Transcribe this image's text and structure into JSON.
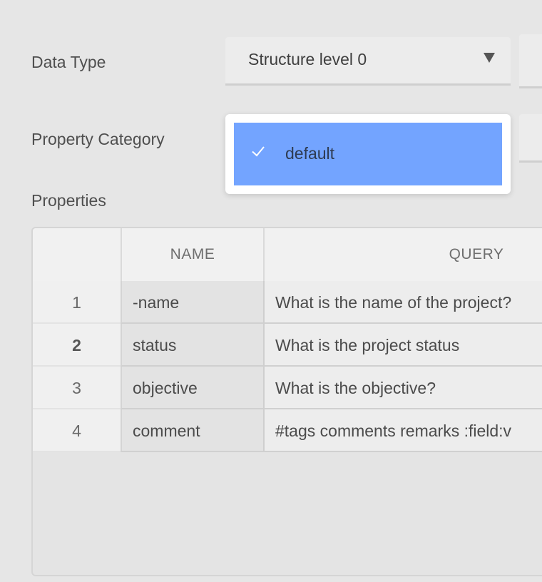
{
  "form": {
    "data_type_label": "Data Type",
    "data_type_value": "Structure level 0",
    "property_category_label": "Property Category",
    "properties_label": "Properties"
  },
  "dropdown": {
    "options": [
      {
        "label": "default",
        "selected": true
      }
    ],
    "selected_color": "#73a4ff"
  },
  "table": {
    "columns": [
      "NAME",
      "QUERY"
    ],
    "rows": [
      {
        "index": "1",
        "name": "-name",
        "query": "What is the name of the project?"
      },
      {
        "index": "2",
        "name": "status",
        "query": "What is the project status"
      },
      {
        "index": "3",
        "name": "objective",
        "query": "What is the objective?"
      },
      {
        "index": "4",
        "name": "comment",
        "query": "#tags comments remarks :field:v"
      }
    ]
  },
  "icons": {
    "select_arrow": "chevron-down-icon",
    "option_check": "check-icon"
  }
}
